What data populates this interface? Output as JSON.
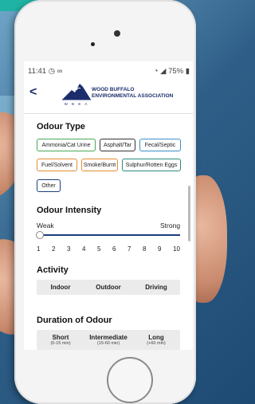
{
  "status": {
    "time": "11:41",
    "icons_left": "◷ ∞",
    "battery": "75%"
  },
  "header": {
    "org_line1": "WOOD BUFFALO",
    "org_line2": "ENVIRONMENTAL ASSOCIATION",
    "logo_letters": "W B E A"
  },
  "odour_type": {
    "title": "Odour Type",
    "chips": [
      "Ammonia/Cat Urine",
      "Asphalt/Tar",
      "Fecal/Septic",
      "Fuel/Solvent",
      "Smoke/Burnt",
      "Sulphur/Rotten Eggs",
      "Other"
    ]
  },
  "intensity": {
    "title": "Odour Intensity",
    "weak": "Weak",
    "strong": "Strong",
    "numbers": [
      "1",
      "2",
      "3",
      "4",
      "5",
      "6",
      "7",
      "8",
      "9",
      "10"
    ],
    "value": 1
  },
  "activity": {
    "title": "Activity",
    "options": [
      "Indoor",
      "Outdoor",
      "Driving"
    ]
  },
  "duration": {
    "title": "Duration of Odour",
    "options": [
      {
        "label": "Short",
        "range": "(0-15 min)"
      },
      {
        "label": "Intermediate",
        "range": "(15-60 min)"
      },
      {
        "label": "Long",
        "range": "(+60 min)"
      }
    ]
  },
  "colors": {
    "navy": "#1b3e80",
    "green": "#4aa656",
    "orange": "#e58c32",
    "teal": "#2a8a7d",
    "blue": "#3a8fc7"
  }
}
